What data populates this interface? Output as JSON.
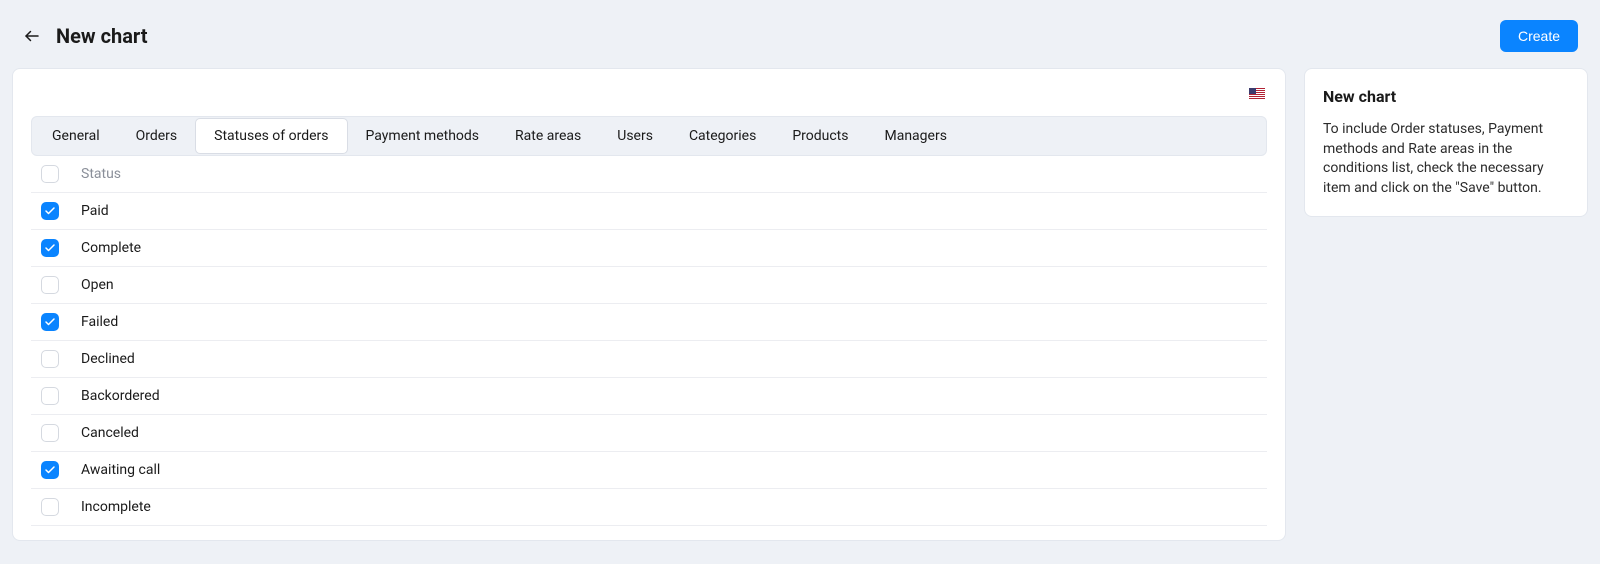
{
  "page_title": "New chart",
  "create_button_label": "Create",
  "language_flag": "en-US",
  "tabs": [
    {
      "label": "General"
    },
    {
      "label": "Orders"
    },
    {
      "label": "Statuses of orders",
      "active": true
    },
    {
      "label": "Payment methods"
    },
    {
      "label": "Rate areas"
    },
    {
      "label": "Users"
    },
    {
      "label": "Categories"
    },
    {
      "label": "Products"
    },
    {
      "label": "Managers"
    }
  ],
  "table": {
    "header_label": "Status",
    "rows": [
      {
        "label": "Paid",
        "checked": true
      },
      {
        "label": "Complete",
        "checked": true
      },
      {
        "label": "Open",
        "checked": false
      },
      {
        "label": "Failed",
        "checked": true
      },
      {
        "label": "Declined",
        "checked": false
      },
      {
        "label": "Backordered",
        "checked": false
      },
      {
        "label": "Canceled",
        "checked": false
      },
      {
        "label": "Awaiting call",
        "checked": true
      },
      {
        "label": "Incomplete",
        "checked": false
      }
    ]
  },
  "sidebar": {
    "title": "New chart",
    "text": "To include Order statuses, Payment methods and Rate areas in the conditions list, check the necessary item and click on the \"Save\" button."
  }
}
